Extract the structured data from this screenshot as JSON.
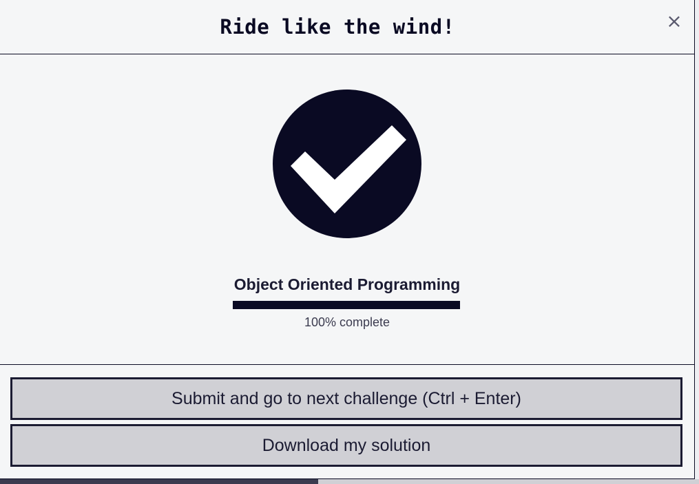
{
  "modal": {
    "title": "Ride like the wind!",
    "close_label": "×"
  },
  "completion": {
    "icon": "check-circle-icon",
    "block_title": "Object Oriented Programming",
    "progress_percent": 100,
    "progress_text": "100% complete"
  },
  "actions": {
    "submit_label": "Submit and go to next challenge (Ctrl + Enter)",
    "download_label": "Download my solution"
  },
  "colors": {
    "primary": "#0a0a23",
    "background": "#f5f6f7",
    "button_bg": "#d0d0d5"
  }
}
